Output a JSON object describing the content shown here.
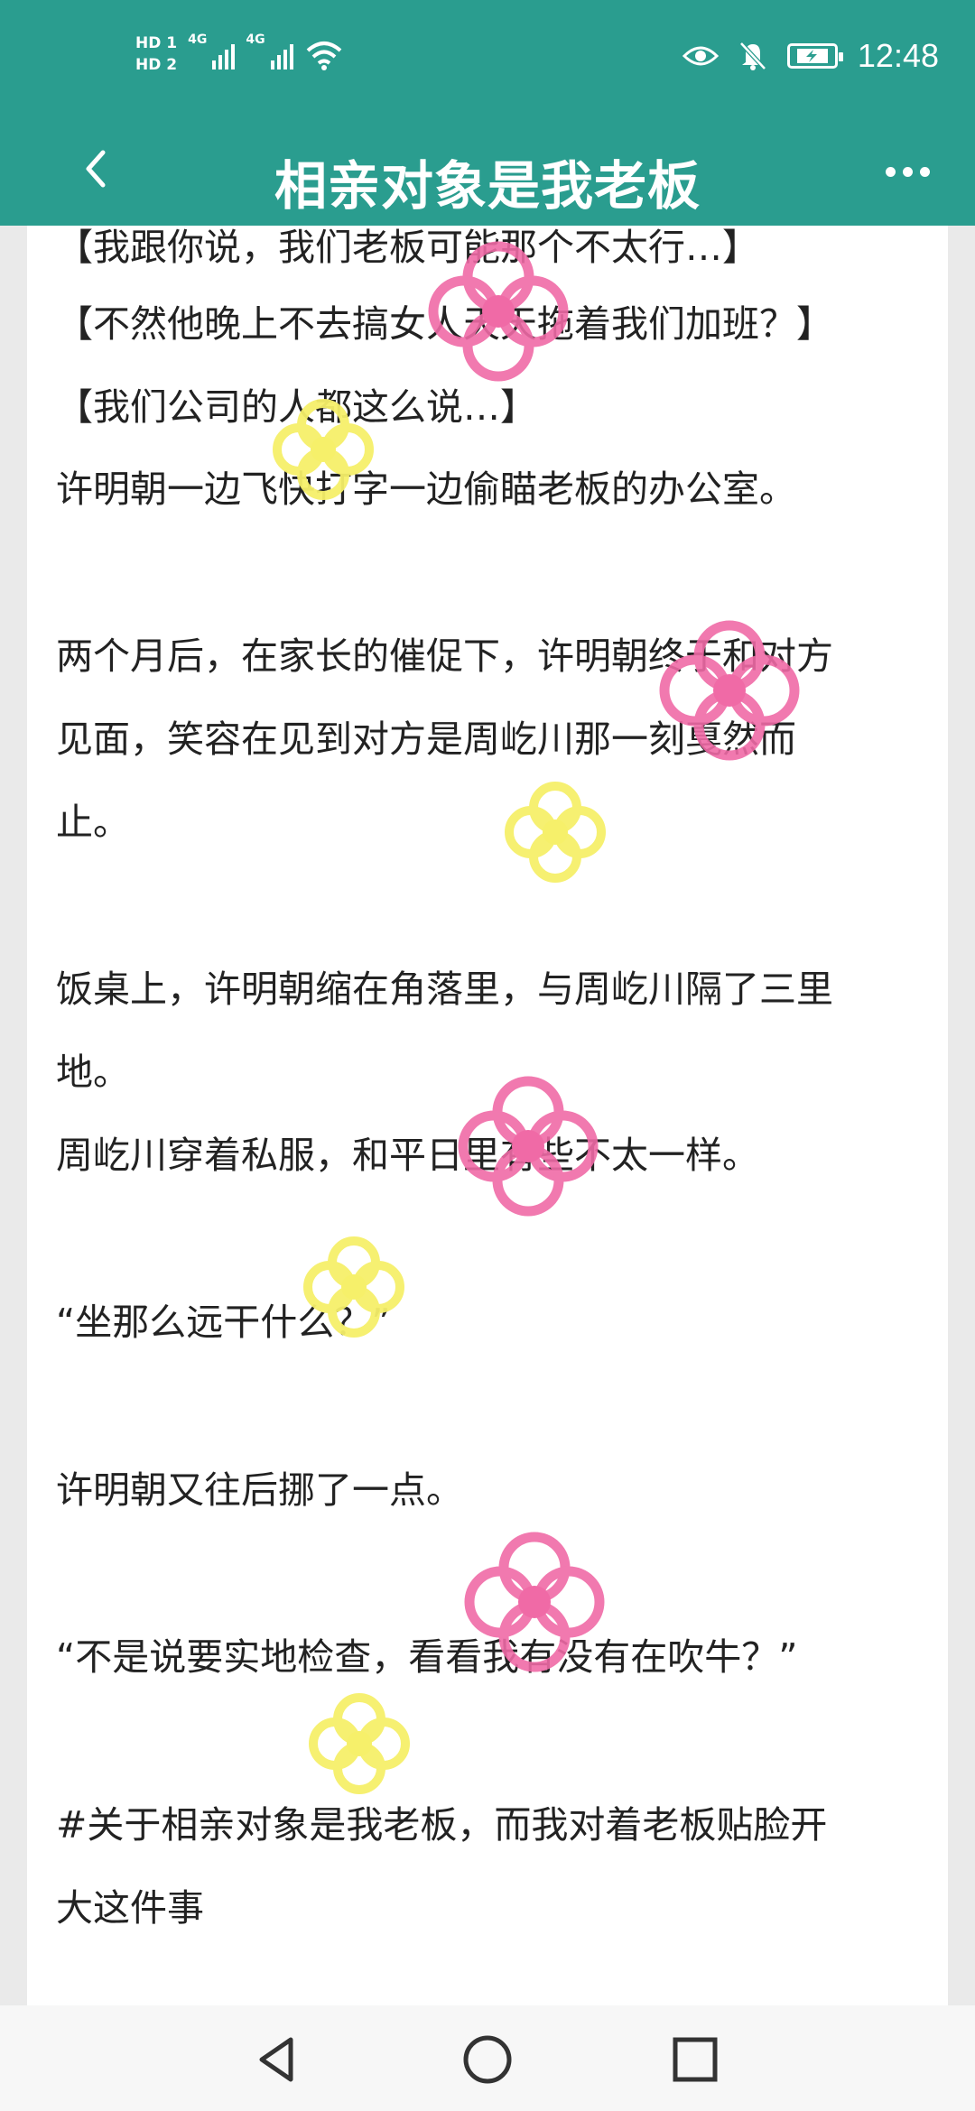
{
  "status_bar": {
    "sim1": "HD 1",
    "sim2": "HD 2",
    "net1": "4G",
    "net2": "4G",
    "time": "12:48",
    "icons": [
      "signal-icon",
      "wifi-icon",
      "eye-icon",
      "mute-bell-icon",
      "battery-charging-icon"
    ]
  },
  "header": {
    "title": "相亲对象是我老板",
    "back_icon": "chevron-left-icon",
    "more_icon": "more-dots-icon"
  },
  "article": {
    "lines": [
      "【我跟你说，我们老板可能那个不太行…】",
      "【不然他晚上不去搞女人天天拖着我们加班？】",
      "【我们公司的人都这么说…】",
      "许明朝一边飞快打字一边偷瞄老板的办公室。",
      "两个月后，在家长的催促下，许明朝终于和对方",
      "见面，笑容在见到对方是周屹川那一刻戛然而",
      "止。",
      "饭桌上，许明朝缩在角落里，与周屹川隔了三里",
      "地。",
      "周屹川穿着私服，和平日里有些不太一样。",
      "“坐那么远干什么？”",
      "许明朝又往后挪了一点。",
      "“不是说要实地检查，看看我有没有在吹牛？”",
      "#关于相亲对象是我老板，而我对着老板贴脸开",
      "大这件事"
    ]
  },
  "decorations": {
    "pink": "#f06aa6",
    "yellow": "#f6f06a",
    "theme": "#2a9d8f"
  },
  "nav_bar": {
    "icons": [
      "nav-back-icon",
      "nav-home-icon",
      "nav-recents-icon"
    ]
  }
}
